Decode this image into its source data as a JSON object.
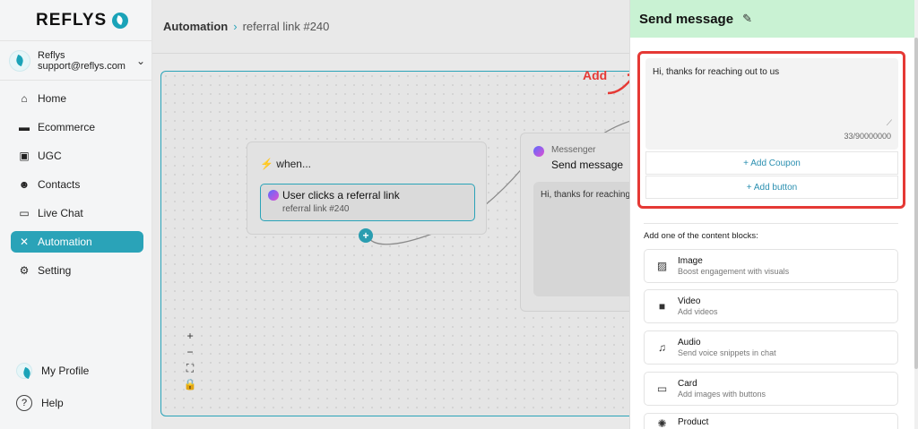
{
  "sidebar": {
    "logo": "REFLYS",
    "account": {
      "name": "Reflys",
      "email": "support@reflys.com"
    },
    "nav": [
      {
        "label": "Home",
        "icon": "home-icon",
        "glyph": "⌂",
        "active": false
      },
      {
        "label": "Ecommerce",
        "icon": "store-icon",
        "glyph": "▬",
        "active": false
      },
      {
        "label": "UGC",
        "icon": "image-icon",
        "glyph": "▣",
        "active": false
      },
      {
        "label": "Contacts",
        "icon": "users-icon",
        "glyph": "☻",
        "active": false
      },
      {
        "label": "Live Chat",
        "icon": "chat-icon",
        "glyph": "▭",
        "active": false
      },
      {
        "label": "Automation",
        "icon": "automation-icon",
        "glyph": "✕",
        "active": true
      },
      {
        "label": "Setting",
        "icon": "gear-icon",
        "glyph": "⚙",
        "active": false
      }
    ],
    "my_profile": "My Profile",
    "help": "Help",
    "accent": "#2aa3b8"
  },
  "breadcrumb": {
    "section": "Automation",
    "page": "referral link #240"
  },
  "canvas": {
    "when_title": "when...",
    "trigger_label": "User clicks a referral link",
    "trigger_sub": "referral link #240",
    "message_channel": "Messenger",
    "message_title": "Send message",
    "message_preview": "Hi, thanks for reaching",
    "zoom_controls": [
      "+",
      "−",
      "⛶",
      "🔒"
    ]
  },
  "annotation": {
    "label": "Add",
    "color": "#e53935"
  },
  "panel": {
    "title": "Send message",
    "header_color": "#c9f2d3",
    "message_text": "Hi, thanks for reaching out to us",
    "counter": "33/90000000",
    "add_coupon": "+ Add Coupon",
    "add_button": "+ Add button",
    "blocks_title": "Add one of the content blocks:",
    "blocks": [
      {
        "name": "Image",
        "desc": "Boost engagement with visuals",
        "icon": "image-icon",
        "glyph": "▨"
      },
      {
        "name": "Video",
        "desc": "Add videos",
        "icon": "video-icon",
        "glyph": "■"
      },
      {
        "name": "Audio",
        "desc": "Send voice snippets in chat",
        "icon": "audio-icon",
        "glyph": "♫"
      },
      {
        "name": "Card",
        "desc": "Add images with buttons",
        "icon": "card-icon",
        "glyph": "▭"
      },
      {
        "name": "Product",
        "desc": "",
        "icon": "product-icon",
        "glyph": "✺"
      }
    ]
  }
}
